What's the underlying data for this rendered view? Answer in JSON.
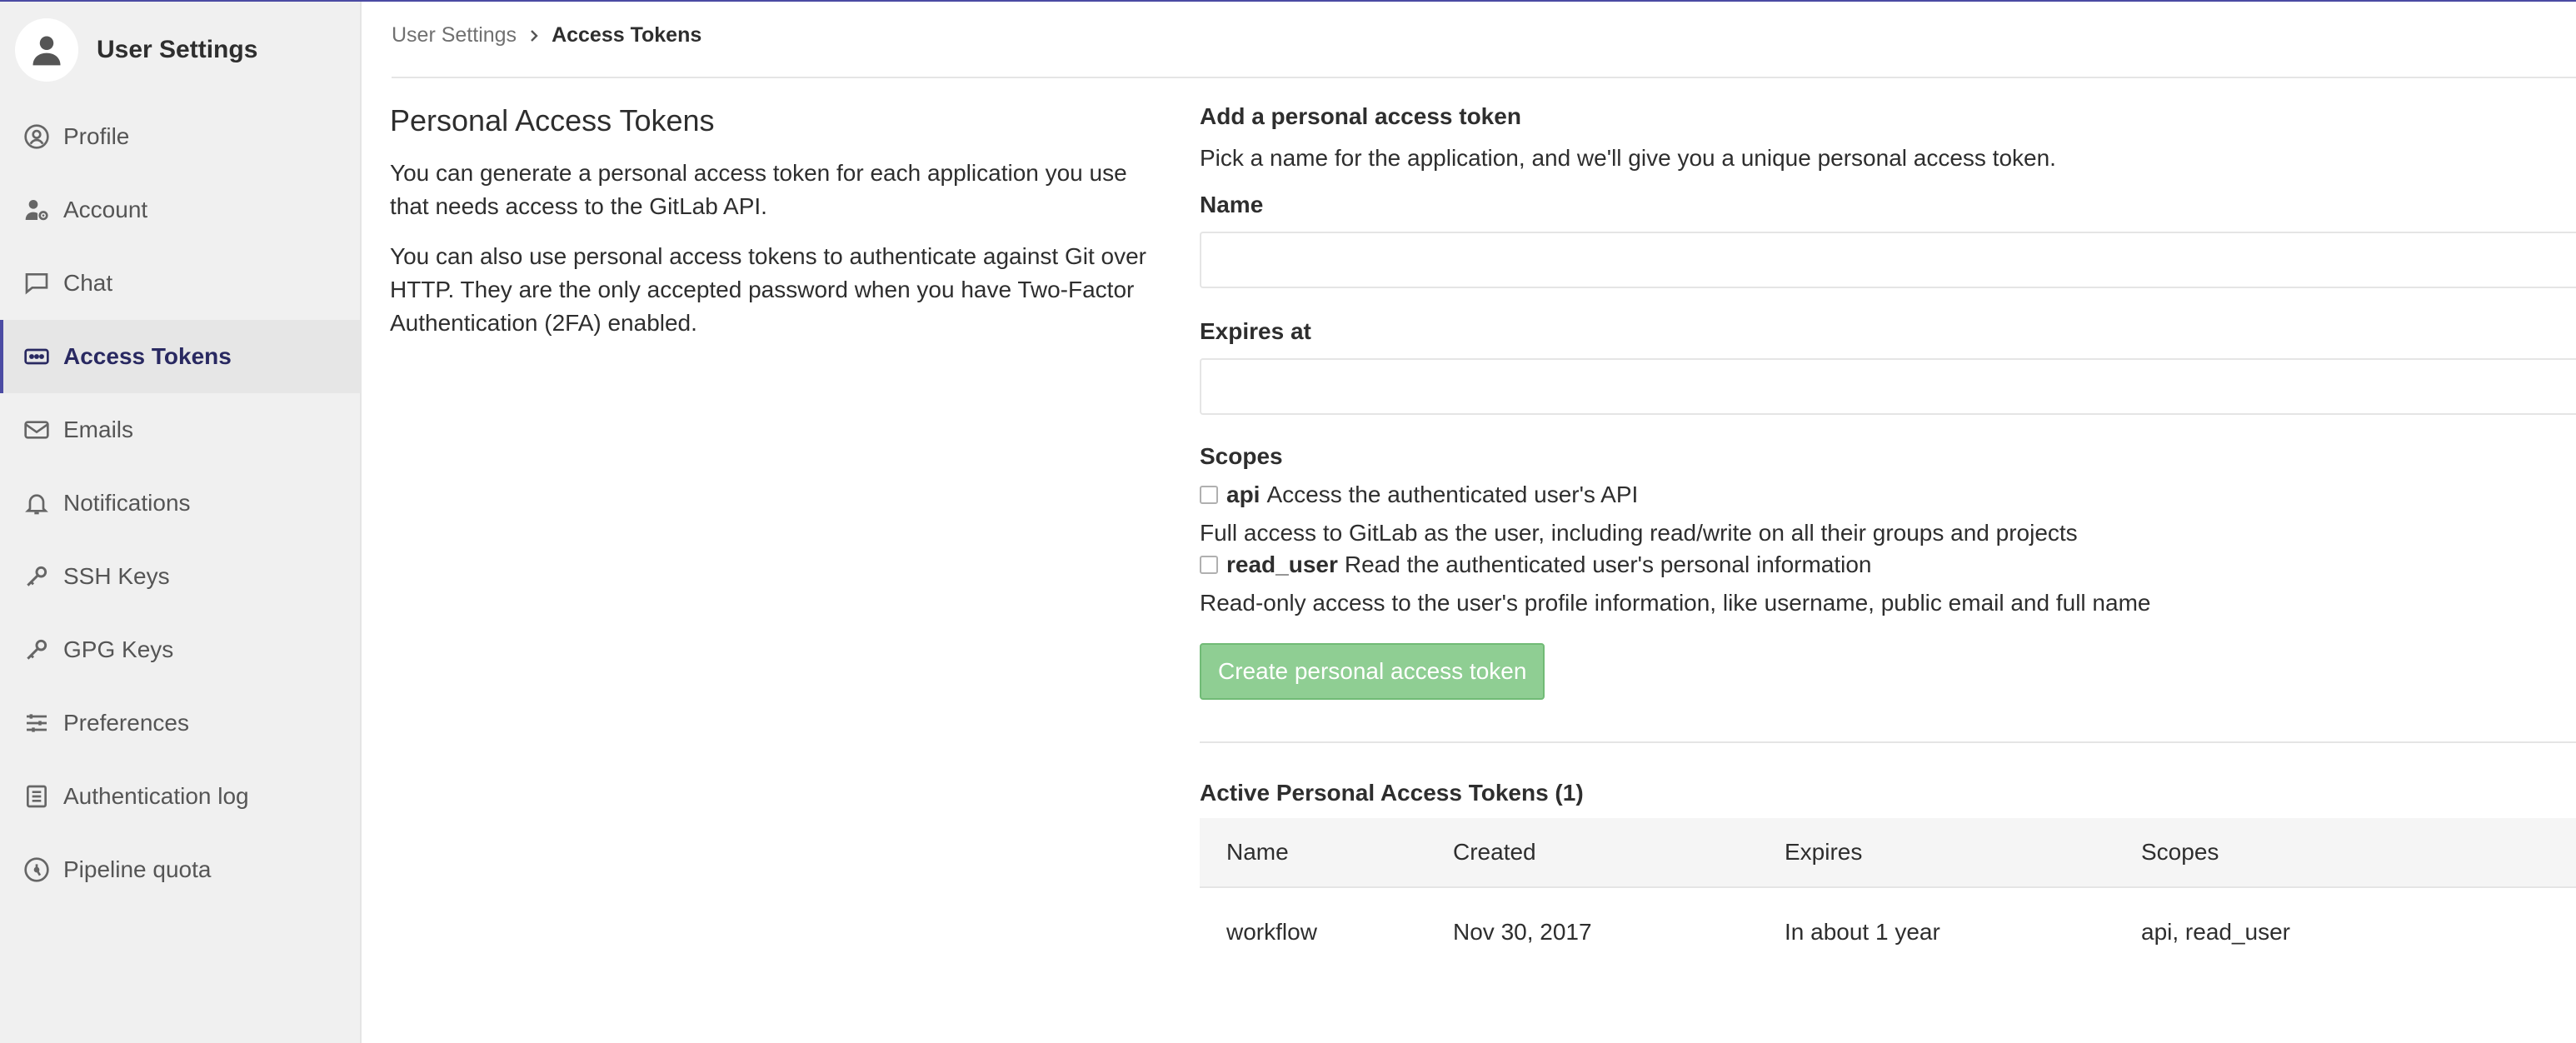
{
  "sidebar": {
    "title": "User Settings",
    "items": [
      {
        "label": "Profile",
        "icon": "profile-icon"
      },
      {
        "label": "Account",
        "icon": "account-icon"
      },
      {
        "label": "Chat",
        "icon": "chat-icon"
      },
      {
        "label": "Access Tokens",
        "icon": "token-icon",
        "active": true
      },
      {
        "label": "Emails",
        "icon": "mail-icon"
      },
      {
        "label": "Notifications",
        "icon": "bell-icon"
      },
      {
        "label": "SSH Keys",
        "icon": "key-icon"
      },
      {
        "label": "GPG Keys",
        "icon": "key-icon"
      },
      {
        "label": "Preferences",
        "icon": "sliders-icon"
      },
      {
        "label": "Authentication log",
        "icon": "list-icon"
      },
      {
        "label": "Pipeline quota",
        "icon": "quota-icon"
      }
    ]
  },
  "breadcrumb": {
    "parent": "User Settings",
    "current": "Access Tokens"
  },
  "intro": {
    "title": "Personal Access Tokens",
    "para1": "You can generate a personal access token for each application you use that needs access to the GitLab API.",
    "para2": "You can also use personal access tokens to authenticate against Git over HTTP. They are the only accepted password when you have Two-Factor Authentication (2FA) enabled."
  },
  "form": {
    "heading": "Add a personal access token",
    "subheading": "Pick a name for the application, and we'll give you a unique personal access token.",
    "name_label": "Name",
    "name_value": "",
    "expires_label": "Expires at",
    "expires_value": "",
    "scopes_label": "Scopes",
    "scopes": [
      {
        "name": "api",
        "desc": "Access the authenticated user's API",
        "help": "Full access to GitLab as the user, including read/write on all their groups and projects",
        "checked": false
      },
      {
        "name": "read_user",
        "desc": "Read the authenticated user's personal information",
        "help": "Read-only access to the user's profile information, like username, public email and full name",
        "checked": false
      }
    ],
    "submit_label": "Create personal access token"
  },
  "active_tokens": {
    "heading": "Active Personal Access Tokens (1)",
    "columns": [
      "Name",
      "Created",
      "Expires",
      "Scopes"
    ],
    "rows": [
      [
        "workflow",
        "Nov 30, 2017",
        "In about 1 year",
        "api, read_user"
      ]
    ]
  },
  "colors": {
    "accent": "#4b4ba3",
    "sidebar_bg": "#f0f0f0",
    "button_green": "#8fce93"
  }
}
